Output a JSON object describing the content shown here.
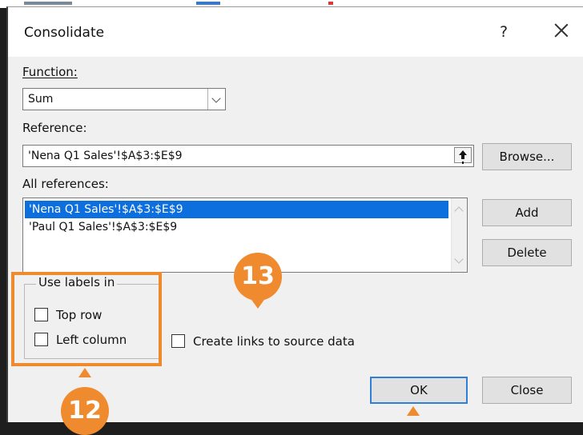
{
  "dialog": {
    "title": "Consolidate",
    "help": "?",
    "function_label": "Function:",
    "function_value": "Sum",
    "reference_label": "Reference:",
    "reference_value": "'Nena Q1 Sales'!$A$3:$E$9",
    "all_references_label": "All references:",
    "all_references": [
      "'Nena Q1 Sales'!$A$3:$E$9",
      "'Paul Q1 Sales'!$A$3:$E$9"
    ],
    "selected_reference_index": 0,
    "buttons": {
      "browse": "Browse...",
      "add": "Add",
      "delete": "Delete",
      "ok": "OK",
      "close": "Close"
    },
    "use_labels": {
      "legend": "Use labels in",
      "top_row": "Top row",
      "left_column": "Left column",
      "top_row_checked": false,
      "left_column_checked": false
    },
    "create_links": {
      "label": "Create links to source data",
      "checked": false
    }
  },
  "callouts": [
    "13",
    "12"
  ],
  "colors": {
    "accent": "#f08a2e",
    "selection": "#0d6ede",
    "default_button_border": "#2f7fd6"
  }
}
